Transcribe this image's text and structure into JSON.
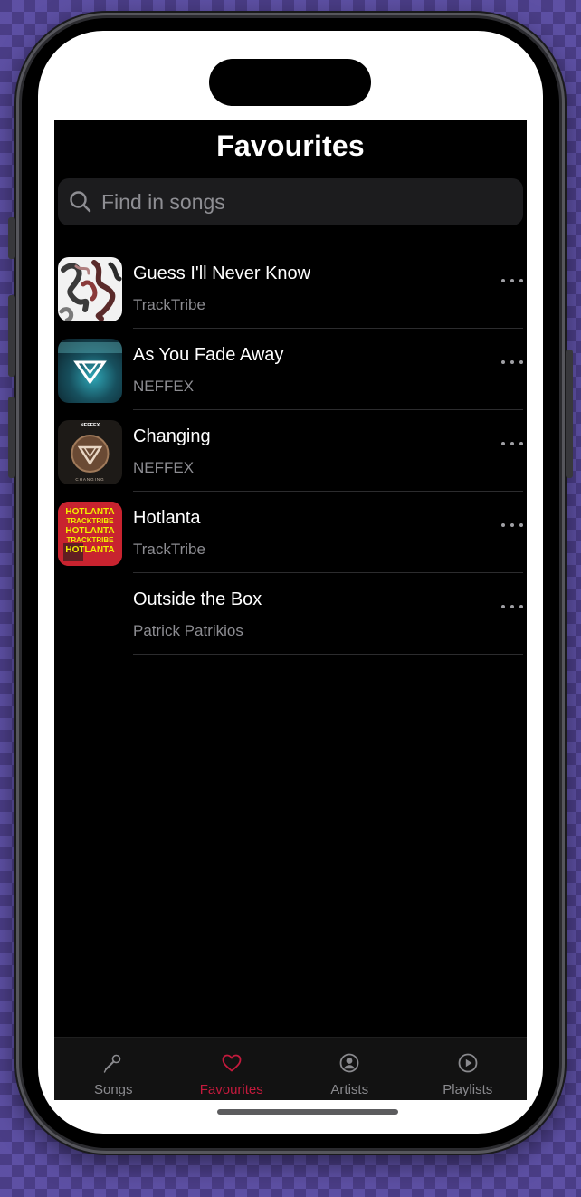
{
  "header": {
    "title": "Favourites"
  },
  "search": {
    "placeholder": "Find in songs"
  },
  "songs": [
    {
      "title": "Guess I'll Never Know",
      "artist": "TrackTribe",
      "art": "guess"
    },
    {
      "title": "As You Fade Away",
      "artist": "NEFFEX",
      "art": "fade"
    },
    {
      "title": "Changing",
      "artist": "NEFFEX",
      "art": "changing",
      "art_text": {
        "top": "NEFFEX",
        "bottom": "CHANGING"
      }
    },
    {
      "title": "Hotlanta",
      "artist": "TrackTribe",
      "art": "hotlanta",
      "art_text": {
        "lines": [
          "HOTLANTA",
          "TRACKTRIBE",
          "HOTLANTA",
          "TRACKTRIBE",
          "HOTLANTA"
        ]
      }
    },
    {
      "title": "Outside the Box",
      "artist": "Patrick Patrikios",
      "art": "none"
    }
  ],
  "tabs": [
    {
      "label": "Songs",
      "icon": "microphone-icon",
      "active": false
    },
    {
      "label": "Favourites",
      "icon": "heart-icon",
      "active": true
    },
    {
      "label": "Artists",
      "icon": "person-circle-icon",
      "active": false
    },
    {
      "label": "Playlists",
      "icon": "play-circle-icon",
      "active": false
    }
  ],
  "colors": {
    "accent": "#c41a3d",
    "background": "#000000",
    "secondary_text": "#8d8d92"
  }
}
